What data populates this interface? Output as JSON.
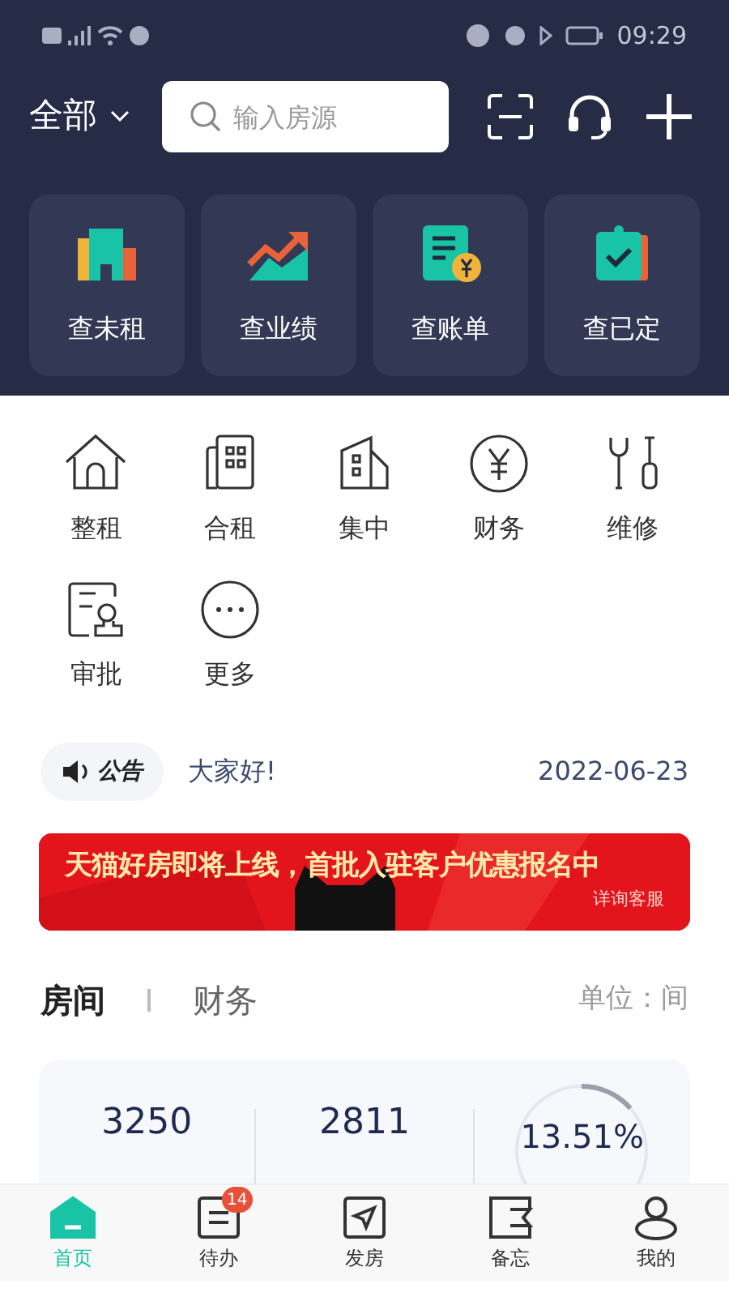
{
  "status_bar": {
    "time": "09:29"
  },
  "header": {
    "scope": "全部",
    "search": {
      "placeholder": "输入房源"
    }
  },
  "quick_cards": [
    {
      "label": "查未租",
      "kind": "building"
    },
    {
      "label": "查业绩",
      "kind": "chart"
    },
    {
      "label": "查账单",
      "kind": "bill"
    },
    {
      "label": "查已定",
      "kind": "clipboard"
    }
  ],
  "menu": [
    {
      "label": "整租",
      "kind": "house"
    },
    {
      "label": "合租",
      "kind": "tower"
    },
    {
      "label": "集中",
      "kind": "block"
    },
    {
      "label": "财务",
      "kind": "yen"
    },
    {
      "label": "维修",
      "kind": "tools"
    },
    {
      "label": "审批",
      "kind": "stamp"
    },
    {
      "label": "更多",
      "kind": "more"
    }
  ],
  "notice": {
    "badge": "公告",
    "text": "大家好!",
    "date": "2022-06-23"
  },
  "banner": {
    "title": "天猫好房即将上线，首批入驻客户优惠报名中",
    "subtitle": "详询客服"
  },
  "tabs": [
    {
      "label": "房间",
      "selected": true
    },
    {
      "label": "财务",
      "selected": false
    }
  ],
  "unit": "单位：间",
  "stats": {
    "values": [
      "3250",
      "2811"
    ],
    "rate": {
      "value": "13.51%",
      "level": 0.1351
    }
  },
  "nav": [
    {
      "label": "首页",
      "selected": true,
      "kind": "home"
    },
    {
      "label": "待办",
      "selected": false,
      "kind": "todo",
      "badge": "14"
    },
    {
      "label": "发房",
      "selected": false,
      "kind": "send"
    },
    {
      "label": "备忘",
      "selected": false,
      "kind": "memo"
    },
    {
      "label": "我的",
      "selected": false,
      "kind": "user"
    }
  ]
}
